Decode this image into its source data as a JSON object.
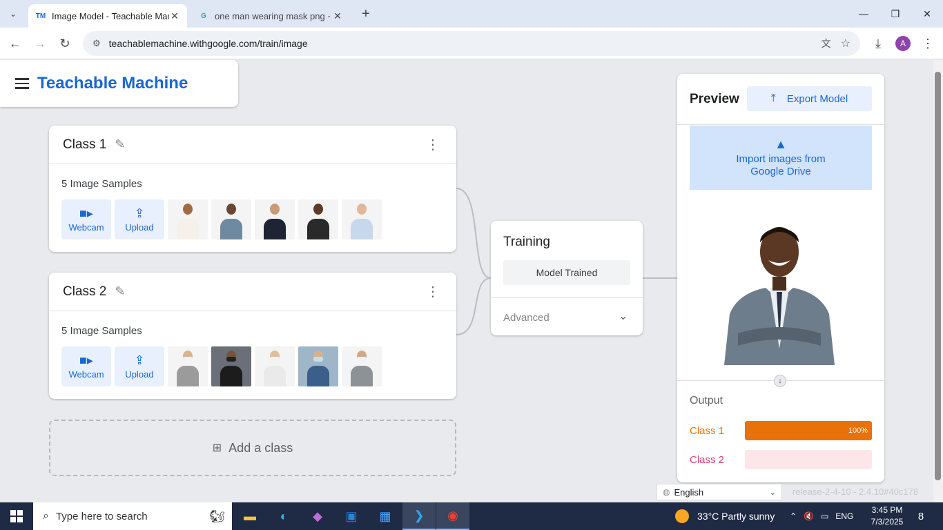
{
  "browser": {
    "tabs": [
      {
        "title": "Image Model - Teachable Mach",
        "favicon": "TM",
        "active": true
      },
      {
        "title": "one man wearing mask png - G",
        "favicon": "G",
        "active": false
      }
    ],
    "new_tab": "+",
    "url": "teachablemachine.withgoogle.com/train/image",
    "profile_initial": "A"
  },
  "app": {
    "logo": "Teachable Machine",
    "classes": [
      {
        "name": "Class 1",
        "samples_label": "5 Image Samples",
        "webcam_label": "Webcam",
        "upload_label": "Upload",
        "thumbnails": [
          "person-turban",
          "person-casual",
          "person-suit",
          "person-suit-dark",
          "person-shirt"
        ]
      },
      {
        "name": "Class 2",
        "samples_label": "5 Image Samples",
        "webcam_label": "Webcam",
        "upload_label": "Upload",
        "thumbnails": [
          "person-mask-grey",
          "person-mask-black",
          "person-mask-glasses",
          "person-mask-blue",
          "person-mask-jacket"
        ]
      }
    ],
    "add_class": "Add a class",
    "training": {
      "title": "Training",
      "button": "Model Trained",
      "advanced": "Advanced"
    },
    "preview": {
      "title": "Preview",
      "export_label": "Export Model",
      "gdrive_line1": "Import images from",
      "gdrive_line2": "Google Drive",
      "output_label": "Output",
      "outputs": [
        {
          "label": "Class 1",
          "percent": 100,
          "percent_text": "100%",
          "color": "#e8710a",
          "track": "#fde4cc"
        },
        {
          "label": "Class 2",
          "percent": 0,
          "percent_text": "",
          "color": "#d93f6d",
          "track": "#fde6ea"
        }
      ]
    },
    "language": "English",
    "release": "release-2-4-10 - 2.4.10#40c178"
  },
  "taskbar": {
    "search_placeholder": "Type here to search",
    "weather": "33°C  Partly sunny",
    "lang": "ENG",
    "time": "3:45 PM",
    "date": "7/3/2025",
    "notifications": "8"
  }
}
